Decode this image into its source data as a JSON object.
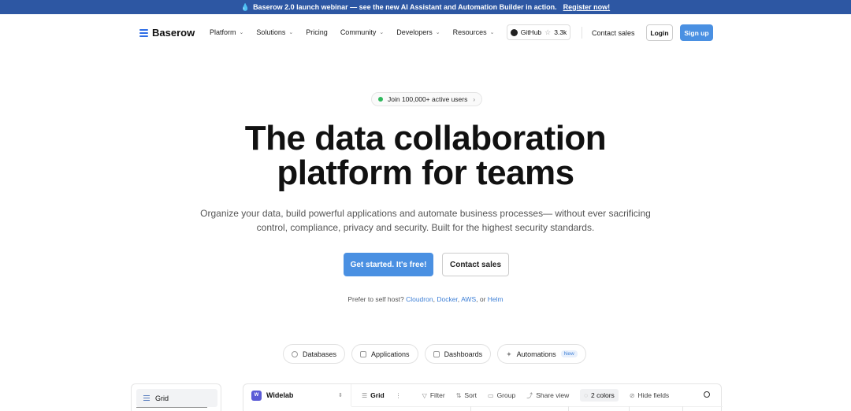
{
  "banner": {
    "icon": "drop-icon",
    "text": "Baserow 2.0 launch webinar — see the new AI Assistant and Automation Builder in action.",
    "link": "Register now!"
  },
  "nav": {
    "logo_text": "Baserow",
    "menu": [
      {
        "label": "Platform",
        "dropdown": true
      },
      {
        "label": "Solutions",
        "dropdown": true
      },
      {
        "label": "Pricing",
        "dropdown": false
      },
      {
        "label": "Community",
        "dropdown": true
      },
      {
        "label": "Developers",
        "dropdown": true
      },
      {
        "label": "Resources",
        "dropdown": true
      }
    ],
    "github_label": "GitHub",
    "github_stars": "3.3k",
    "contact_sales": "Contact sales",
    "login": "Login",
    "signup": "Sign up"
  },
  "hero": {
    "pill_text": "Join 100,000+ active users",
    "title_line1": "The data collaboration",
    "title_line2": "platform for teams",
    "subtitle_line1": "Organize your data, build powerful applications and automate business processes— without ever sacrificing",
    "subtitle_line2": "control, compliance, privacy and security. Built for the highest security standards.",
    "cta_primary": "Get started. It's free!",
    "cta_secondary": "Contact sales",
    "selfhost_prefix": "Prefer to self host?",
    "selfhost_links": [
      "Cloudron",
      "Docker",
      "AWS",
      "Helm"
    ],
    "selfhost_sep1": ",",
    "selfhost_sep2": ",",
    "selfhost_or": ", or"
  },
  "tabs": [
    {
      "label": "Databases",
      "icon": "database-icon"
    },
    {
      "label": "Applications",
      "icon": "window-icon"
    },
    {
      "label": "Dashboards",
      "icon": "grid-icon"
    },
    {
      "label": "Automations",
      "icon": "sparkle-icon",
      "badge": "New"
    }
  ],
  "preview": {
    "sidebar_item": "Grid",
    "workspace_badge": "W",
    "workspace_name": "Widelab",
    "view_name": "Grid",
    "toolbar": {
      "filter": "Filter",
      "sort": "Sort",
      "group": "Group",
      "share": "Share view",
      "colors": "2 colors",
      "hide": "Hide fields"
    }
  },
  "colors": {
    "banner_bg": "#2d57a3",
    "accent": "#4a90e2",
    "link": "#3d7fd6",
    "online": "#2eb85c"
  }
}
